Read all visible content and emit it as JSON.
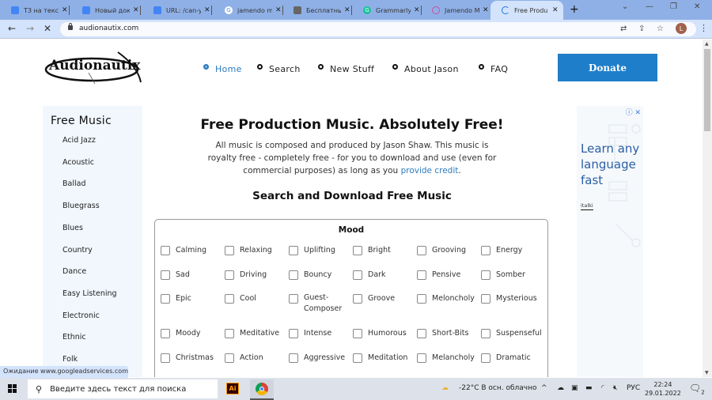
{
  "browser": {
    "tabs": [
      {
        "title": "ТЗ на текст",
        "icon": "docs-icon",
        "color": "#4285f4"
      },
      {
        "title": "Новый док",
        "icon": "docs-icon",
        "color": "#4285f4"
      },
      {
        "title": "URL: /can-y",
        "icon": "docs-icon",
        "color": "#4285f4"
      },
      {
        "title": "jamendo m",
        "icon": "google-icon",
        "color": "#ffffff"
      },
      {
        "title": "Бесплатны",
        "icon": "page-icon",
        "color": "#666666"
      },
      {
        "title": "Grammarly",
        "icon": "grammarly-icon",
        "color": "#15c39a"
      },
      {
        "title": "Jamendo M",
        "icon": "jamendo-icon",
        "color": "#c94fa0"
      },
      {
        "title": "Free Produ",
        "icon": "loading-spinner-icon",
        "color": "#1a73e8",
        "active": true
      }
    ],
    "new_tab": "+",
    "url": "audionautix.com",
    "profile_initial": "L",
    "status_text": "Ожидание www.googleadservices.com..."
  },
  "site": {
    "logo_text": "Audionautix",
    "nav": [
      {
        "label": "Home",
        "active": true
      },
      {
        "label": "Search"
      },
      {
        "label": "New Stuff"
      },
      {
        "label": "About Jason"
      },
      {
        "label": "FAQ"
      }
    ],
    "donate_label": "Donate",
    "sidebar": {
      "title": "Free Music",
      "items": [
        "Acid Jazz",
        "Acoustic",
        "Ballad",
        "Bluegrass",
        "Blues",
        "Country",
        "Dance",
        "Easy Listening",
        "Electronic",
        "Ethnic",
        "Folk"
      ]
    },
    "main": {
      "title": "Free Production Music. Absolutely Free!",
      "intro": "All music is composed and produced by Jason Shaw. This music is royalty free - completely free - for you to download and use (even for commercial purposes) as long as you ",
      "intro_link": "provide credit",
      "intro_end": ".",
      "search_title": "Search and Download Free Music",
      "mood_label": "Mood",
      "moods": [
        [
          "Calming",
          "Relaxing",
          "Uplifting",
          "Bright",
          "Grooving",
          "Energy"
        ],
        [
          "Sad",
          "Driving",
          "Bouncy",
          "Dark",
          "Pensive",
          "Somber"
        ],
        [
          "Epic",
          "Cool",
          "Guest-Composer",
          "Groove",
          "Meloncholy",
          "Mysterious"
        ],
        [
          "Moody",
          "Meditative",
          "Intense",
          "Humorous",
          "Short-Bits",
          "Suspenseful"
        ],
        [
          "Christmas",
          "Action",
          "Aggressive",
          "Meditation",
          "Melancholy",
          "Dramatic"
        ]
      ]
    },
    "ad": {
      "headline": "Learn any language fast",
      "brand": "italki",
      "info_icon": "ⓘ",
      "close_icon": "✕"
    }
  },
  "taskbar": {
    "search_placeholder": "Введите здесь текст для поиска",
    "weather": "-22°C  В осн. облачно",
    "language": "РУС",
    "time": "22:24",
    "date": "29.01.2022",
    "notifications": "2"
  }
}
